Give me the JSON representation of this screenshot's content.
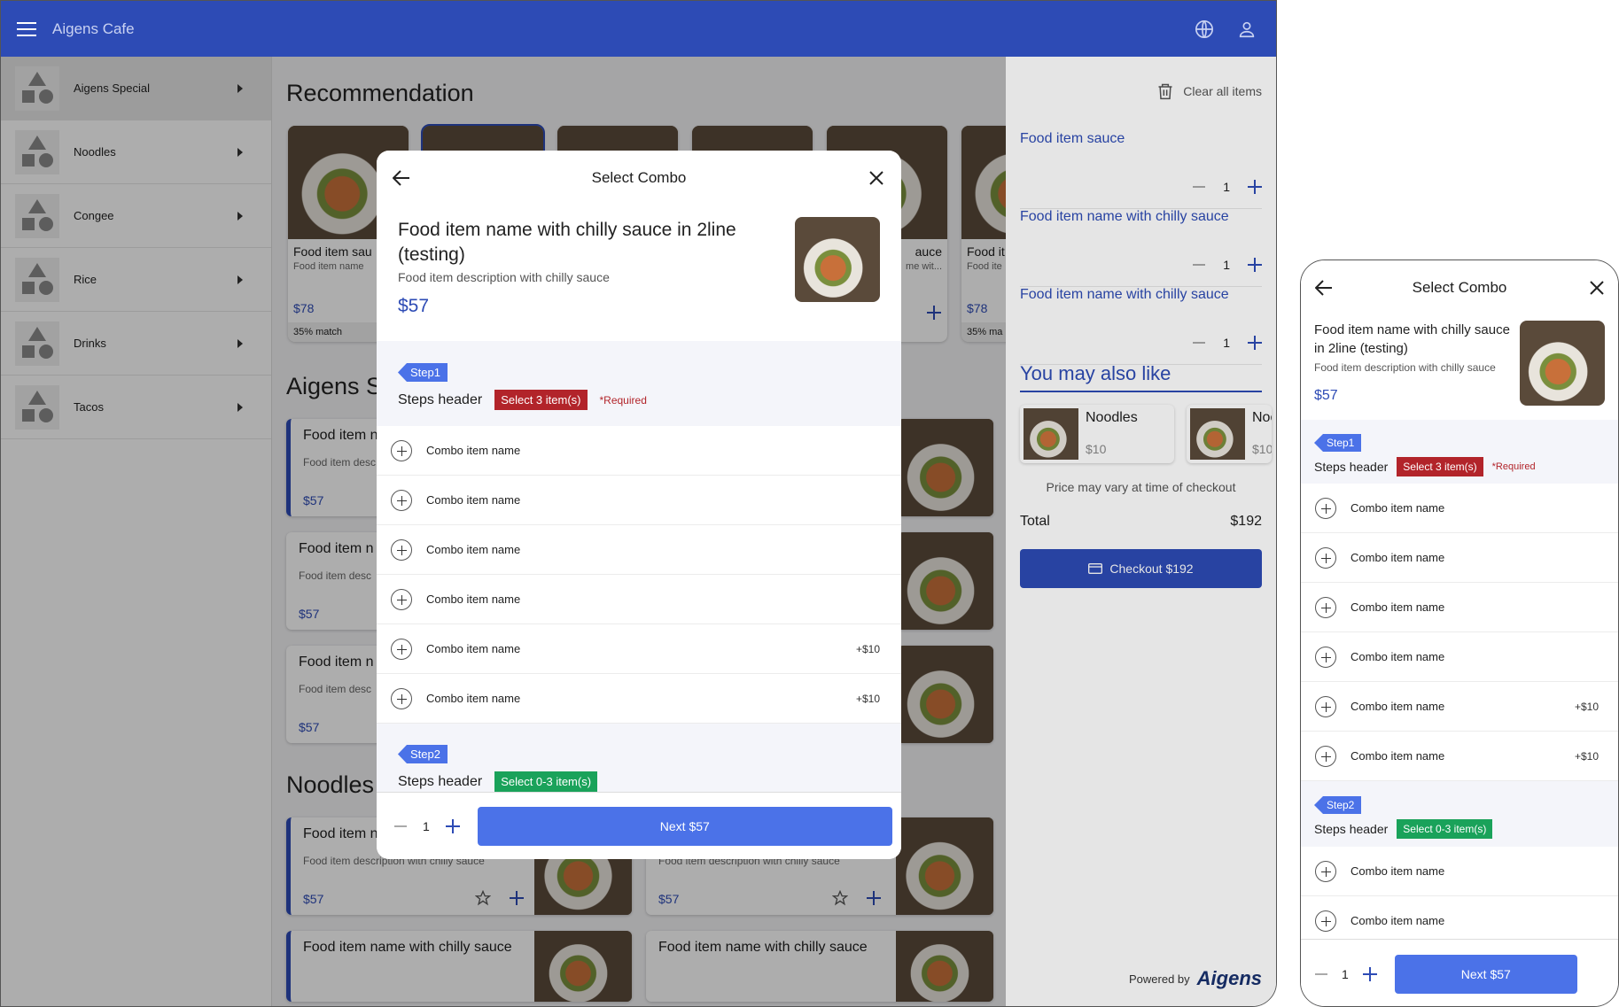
{
  "app": {
    "title": "Aigens Cafe"
  },
  "sidebar": {
    "items": [
      {
        "label": "Aigens Special"
      },
      {
        "label": "Noodles"
      },
      {
        "label": "Congee"
      },
      {
        "label": "Rice"
      },
      {
        "label": "Drinks"
      },
      {
        "label": "Tacos"
      }
    ]
  },
  "content": {
    "recommendation_title": "Recommendation",
    "section2_title": "Aigens S",
    "section3_title": "Noodles",
    "rec_cards": [
      {
        "name": "Food item sau",
        "desc": "Food item name",
        "price": "$78",
        "match": "35% match"
      },
      {
        "name": "",
        "desc": "",
        "price": "",
        "match": ""
      },
      {
        "name": "",
        "desc": "",
        "price": "",
        "match": ""
      },
      {
        "name": "",
        "desc": "",
        "price": "",
        "match": ""
      },
      {
        "name": "auce",
        "desc": "me wit...",
        "price": "",
        "match": ""
      },
      {
        "name": "Food it",
        "desc": "Food ite",
        "price": "$78",
        "match": "35% ma"
      }
    ],
    "list_cards": [
      {
        "name": "Food item n",
        "desc": "Food item desc",
        "price": "$57"
      },
      {
        "name": "Food item n",
        "desc": "Food item desc",
        "price": "$57"
      },
      {
        "name": "Food item n",
        "desc": "Food item desc",
        "price": "$57"
      }
    ],
    "noodle_cards": [
      {
        "name": "Food item n",
        "desc": "Food item description with chilly sauce",
        "price": "$57"
      },
      {
        "name": "",
        "desc": "Food item description with chilly sauce",
        "price": "$57"
      },
      {
        "name": "Food item name with chilly sauce"
      },
      {
        "name": "Food item name with chilly sauce"
      }
    ]
  },
  "cart": {
    "clear_label": "Clear all items",
    "items": [
      {
        "name": "Food item sauce",
        "qty": "1"
      },
      {
        "name": "Food item name with chilly sauce",
        "qty": "1"
      },
      {
        "name": "Food item name with chilly sauce",
        "qty": "1"
      }
    ],
    "you_may_also_like": "You may also like",
    "suggestions": [
      {
        "name": "Noodles",
        "price": "$10"
      },
      {
        "name": "Noo",
        "price": "$10"
      }
    ],
    "note": "Price may vary at time of checkout",
    "total_label": "Total",
    "total_value": "$192",
    "checkout_label": "Checkout $192",
    "powered_by": "Powered by",
    "logo": "Aigens"
  },
  "dialog": {
    "title": "Select Combo",
    "item_name": "Food item name with chilly sauce in 2line (testing)",
    "item_desc": "Food item description with chilly sauce",
    "item_price": "$57",
    "step1": {
      "tag": "Step1",
      "header": "Steps header",
      "badge": "Select 3 item(s)",
      "required": "*Required"
    },
    "step2": {
      "tag": "Step2",
      "header": "Steps header",
      "badge": "Select 0-3 item(s)"
    },
    "combo_items": [
      {
        "name": "Combo item name",
        "extra": ""
      },
      {
        "name": "Combo item name",
        "extra": ""
      },
      {
        "name": "Combo item name",
        "extra": ""
      },
      {
        "name": "Combo item name",
        "extra": ""
      },
      {
        "name": "Combo item name",
        "extra": "+$10"
      },
      {
        "name": "Combo item name",
        "extra": "+$10"
      }
    ],
    "step2_items": [
      {
        "name": "Combo item name"
      },
      {
        "name": "Combo item name"
      }
    ],
    "qty": "1",
    "next_label": "Next $57"
  },
  "phone": {
    "item_name": "Food item name with chilly sauce in 2line (testing)"
  },
  "colors": {
    "primary": "#2d4bb5",
    "accent": "#4b72e8",
    "required": "#b2242a",
    "optional": "#1aa25a"
  }
}
